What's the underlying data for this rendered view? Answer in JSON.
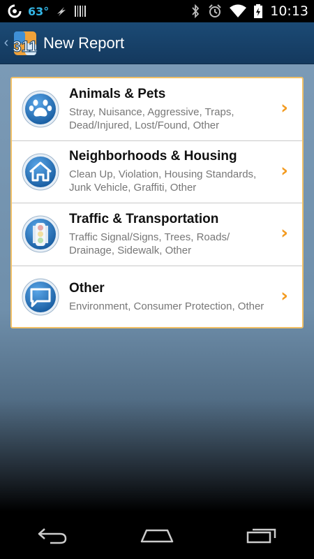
{
  "status_bar": {
    "temperature": "63°",
    "time": "10:13"
  },
  "app_bar": {
    "logo_text": "311",
    "title": "New Report"
  },
  "categories": [
    {
      "icon": "paw-icon",
      "title": "Animals & Pets",
      "description": "Stray, Nuisance, Aggressive, Traps, Dead/Injured, Lost/Found, Other"
    },
    {
      "icon": "house-icon",
      "title": "Neighborhoods & Housing",
      "description": "Clean Up, Violation, Housing Standards, Junk Vehicle, Graffiti, Other"
    },
    {
      "icon": "traffic-light-icon",
      "title": "Traffic & Transportation",
      "description": "Traffic Signal/Signs, Trees, Roads/ Drainage, Sidewalk, Other"
    },
    {
      "icon": "speech-bubble-icon",
      "title": "Other",
      "description": "Environment, Consumer Protection, Other"
    }
  ],
  "colors": {
    "accent_orange": "#f39a1e",
    "app_bar_blue": "#1b4a75",
    "card_border": "#f1c066",
    "icon_blue": "#1f6fb5"
  }
}
